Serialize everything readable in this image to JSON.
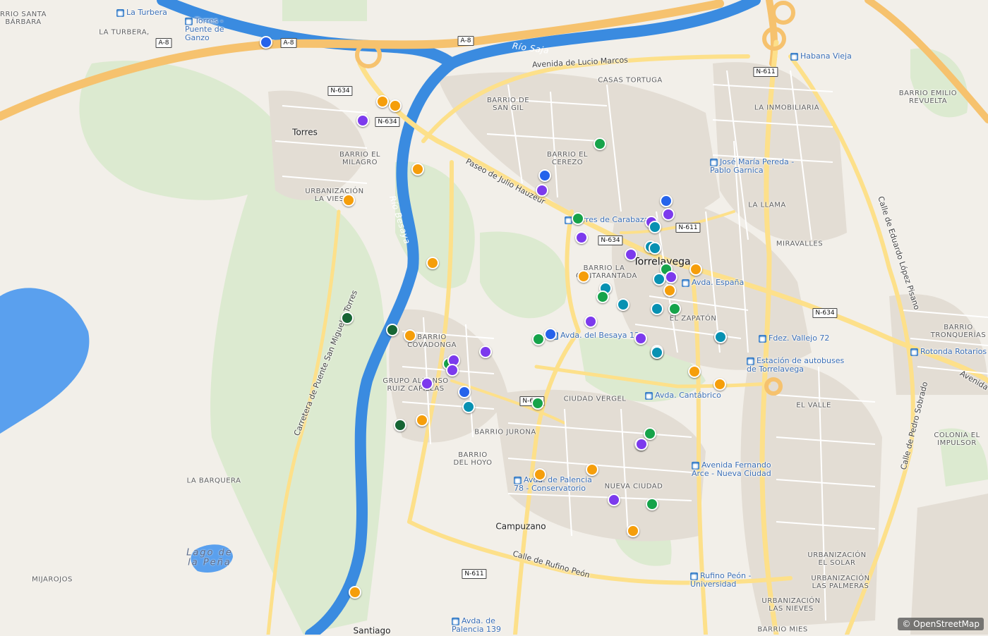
{
  "map": {
    "attribution": "© OpenStreetMap",
    "colors": {
      "background": "#f2efe9",
      "park": "#d9e8cf",
      "motorway": "#f6c26e",
      "road": "#fde08a",
      "river": "#3a8be0",
      "lake": "#5aa0ee",
      "orange": "#f59e0b",
      "purple": "#7c3aed",
      "blue": "#2563eb",
      "green": "#16a34a",
      "teal": "#0891b2",
      "darkgreen": "#166534"
    },
    "labels": {
      "town": [
        {
          "name": "Torres"
        },
        {
          "name": "Campuzano"
        },
        {
          "name": "Santiago"
        }
      ],
      "city": [
        {
          "name": "Torrelavega"
        }
      ],
      "place": [
        {
          "name": "RRIO SANTA BÁRBARA"
        },
        {
          "name": "LA TURBERA,"
        },
        {
          "name": "BARRIO EL MILAGRO"
        },
        {
          "name": "URBANIZACIÓN LA VIESCA"
        },
        {
          "name": "BARRIO DE SAN GIL"
        },
        {
          "name": "CASAS TORTUGA"
        },
        {
          "name": "BARRIO EL CEREZO"
        },
        {
          "name": "LA INMOBILIARIA"
        },
        {
          "name": "BARRIO EMILIO REVUELTA"
        },
        {
          "name": "LA LLAMA"
        },
        {
          "name": "MIRAVALLES"
        },
        {
          "name": "BARRIO COVADONGA"
        },
        {
          "name": "GRUPO ALFONSO RUIZ CAPILLAS"
        },
        {
          "name": "BARRIO LA CANTARANTADA"
        },
        {
          "name": "EL ZAPATÓN"
        },
        {
          "name": "CIUDAD VERGEL"
        },
        {
          "name": "BARRIO JURONA"
        },
        {
          "name": "BARRIO DEL HOYO"
        },
        {
          "name": "NUEVA CIUDAD"
        },
        {
          "name": "EL VALLE"
        },
        {
          "name": "COLONIA EL IMPULSOR"
        },
        {
          "name": "BARRIO TRONQUERÍAS"
        },
        {
          "name": "LA BARQUERA"
        },
        {
          "name": "MIJAROJOS"
        },
        {
          "name": "URBANIZACIÓN EL SOLAR"
        },
        {
          "name": "URBANIZACIÓN LAS PALMERAS"
        },
        {
          "name": "URBANIZACIÓN LAS NIEVES"
        },
        {
          "name": "BARRIO MIES"
        }
      ],
      "water": [
        {
          "name": "Río Saja"
        },
        {
          "name": "Río Besaya"
        },
        {
          "name": "Lago de la Peña"
        }
      ],
      "street": [
        {
          "name": "Avenida de Lucio Marcos"
        },
        {
          "name": "Paseo de Julio Hauzeur"
        },
        {
          "name": "Carretera de Puente San Miguel a Torres"
        },
        {
          "name": "Calle de Eduardo López Pisano"
        },
        {
          "name": "Calle de Pedro Sobrado"
        },
        {
          "name": "Calle de Rufino Peón"
        },
        {
          "name": "Avenida"
        }
      ],
      "bus": [
        {
          "name": "La Turbera"
        },
        {
          "name": "Torres - Puente de Ganzo"
        },
        {
          "name": "Habana Vieja"
        },
        {
          "name": "José María Pereda - Pablo Garnica"
        },
        {
          "name": "Torres de Carabaza"
        },
        {
          "name": "Avda. España"
        },
        {
          "name": "Avda. del Besaya 12"
        },
        {
          "name": "Fdez. Vallejo 72"
        },
        {
          "name": "Rotonda Rotarios"
        },
        {
          "name": "Estación de autobuses de Torrelavega"
        },
        {
          "name": "Avda. Cantábrico"
        },
        {
          "name": "Avenida Fernando Arce - Nueva Ciudad"
        },
        {
          "name": "Avda. de Palencia 78 - Conservatorio"
        },
        {
          "name": "Rufino Peón - Universidad"
        },
        {
          "name": "Avda. de Palencia 139"
        }
      ],
      "shields": [
        "A-8",
        "A-8",
        "A-8",
        "N-634",
        "N-634",
        "N-634",
        "N-634",
        "N-611",
        "N-611",
        "N-611",
        "N-611"
      ]
    },
    "markers": [
      {
        "color": "blue"
      },
      {
        "color": "orange"
      },
      {
        "color": "orange"
      },
      {
        "color": "purple"
      },
      {
        "color": "orange"
      },
      {
        "color": "orange"
      },
      {
        "color": "orange"
      },
      {
        "color": "darkgreen"
      },
      {
        "color": "darkgreen"
      },
      {
        "color": "orange"
      },
      {
        "color": "green"
      },
      {
        "color": "purple"
      },
      {
        "color": "purple"
      },
      {
        "color": "purple"
      },
      {
        "color": "purple"
      },
      {
        "color": "blue"
      },
      {
        "color": "teal"
      },
      {
        "color": "darkgreen"
      },
      {
        "color": "orange"
      },
      {
        "color": "blue"
      },
      {
        "color": "purple"
      },
      {
        "color": "green"
      },
      {
        "color": "green"
      },
      {
        "color": "purple"
      },
      {
        "color": "orange"
      },
      {
        "color": "teal"
      },
      {
        "color": "green"
      },
      {
        "color": "teal"
      },
      {
        "color": "purple"
      },
      {
        "color": "blue"
      },
      {
        "color": "green"
      },
      {
        "color": "orange"
      },
      {
        "color": "green"
      },
      {
        "color": "purple"
      },
      {
        "color": "orange"
      },
      {
        "color": "orange"
      },
      {
        "color": "purple"
      },
      {
        "color": "green"
      },
      {
        "color": "orange"
      },
      {
        "color": "blue"
      },
      {
        "color": "purple"
      },
      {
        "color": "purple"
      },
      {
        "color": "teal"
      },
      {
        "color": "teal"
      },
      {
        "color": "purple"
      },
      {
        "color": "teal"
      },
      {
        "color": "teal"
      },
      {
        "color": "green"
      },
      {
        "color": "purple"
      },
      {
        "color": "teal"
      },
      {
        "color": "orange"
      },
      {
        "color": "orange"
      },
      {
        "color": "teal"
      },
      {
        "color": "green"
      },
      {
        "color": "teal"
      },
      {
        "color": "purple"
      },
      {
        "color": "teal"
      },
      {
        "color": "orange"
      },
      {
        "color": "teal"
      },
      {
        "color": "orange"
      },
      {
        "color": "orange"
      },
      {
        "color": "green"
      },
      {
        "color": "purple"
      }
    ]
  }
}
